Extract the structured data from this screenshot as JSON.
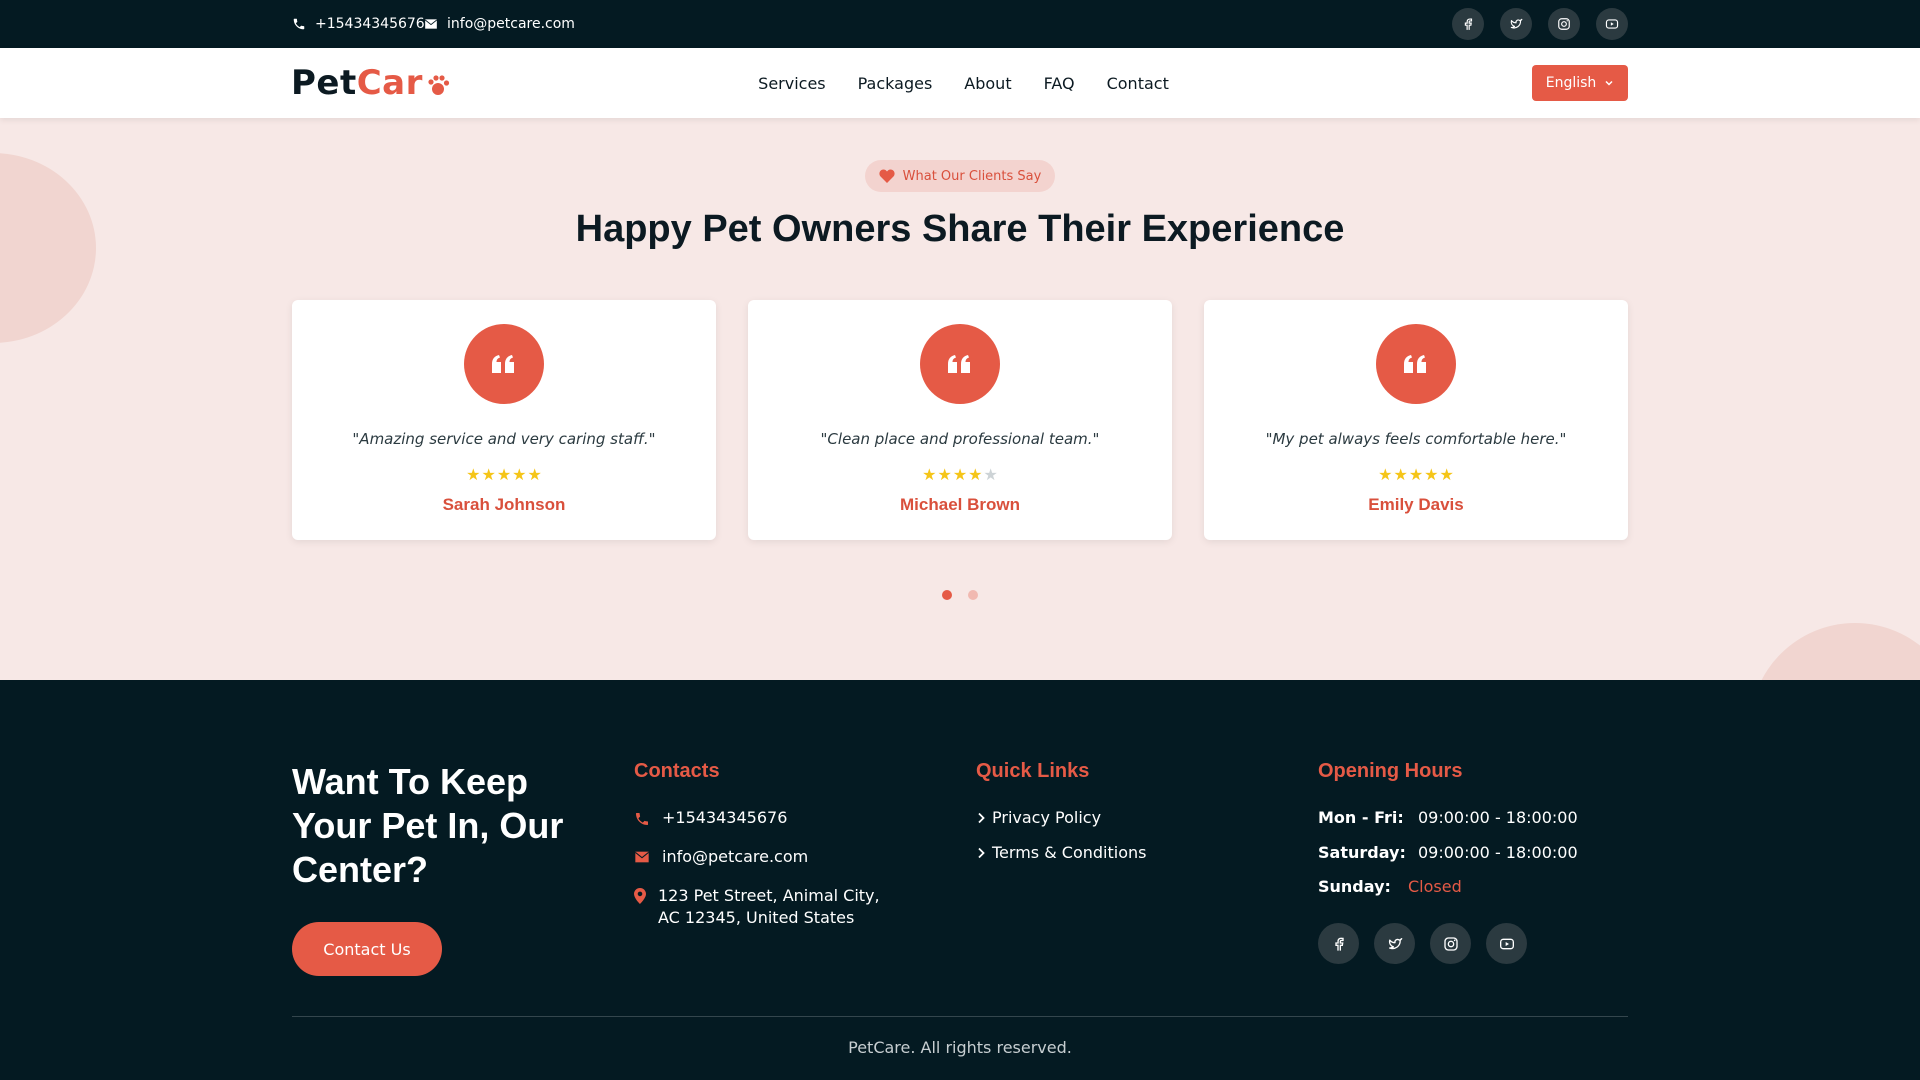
{
  "topbar": {
    "phone": "+15434345676",
    "email": "info@petcare.com",
    "social": [
      "facebook-icon",
      "twitter-icon",
      "instagram-icon",
      "youtube-icon"
    ]
  },
  "navbar": {
    "logo_part1": "Pet",
    "logo_part2": "Car",
    "links": [
      "Services",
      "Packages",
      "About",
      "FAQ",
      "Contact"
    ],
    "language": "English"
  },
  "testimonials": {
    "badge": "What Our Clients Say",
    "title": "Happy Pet Owners Share Their Experience",
    "items": [
      {
        "quote": "\"Amazing service and very caring staff.\"",
        "rating": 5,
        "name": "Sarah Johnson"
      },
      {
        "quote": "\"Clean place and professional team.\"",
        "rating": 4,
        "name": "Michael Brown"
      },
      {
        "quote": "\"My pet always feels comfortable here.\"",
        "rating": 5,
        "name": "Emily Davis"
      }
    ],
    "pages": 2,
    "active_page": 1
  },
  "footer": {
    "cta_title": "Want To Keep Your Pet In, Our Center?",
    "cta_button": "Contact Us",
    "contacts": {
      "title": "Contacts",
      "phone": "+15434345676",
      "email": "info@petcare.com",
      "address_line1": "123 Pet Street, Animal City,",
      "address_line2": "AC 12345, United States"
    },
    "quick_links": {
      "title": "Quick Links",
      "items": [
        "Privacy Policy",
        "Terms & Conditions"
      ]
    },
    "opening_hours": {
      "title": "Opening Hours",
      "rows": [
        {
          "day": "Mon - Fri:",
          "hours": "09:00:00 - 18:00:00"
        },
        {
          "day": "Saturday:",
          "hours": "09:00:00 - 18:00:00"
        },
        {
          "day": "Sunday:",
          "hours": "Closed"
        }
      ]
    },
    "copyright": "PetCare. All rights reserved."
  },
  "colors": {
    "accent": "#e55a46",
    "dark": "#041a22",
    "section_bg": "#f7e8e6",
    "star": "#f5c518"
  }
}
